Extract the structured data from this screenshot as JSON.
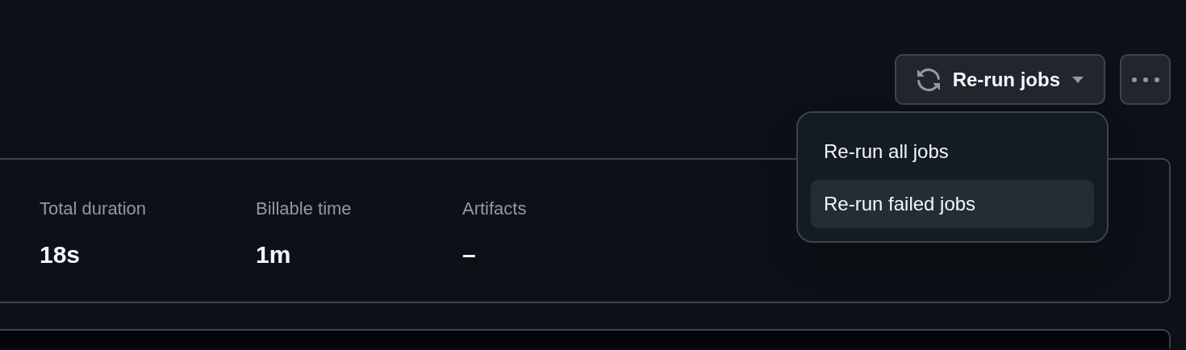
{
  "actions": {
    "rerun_button": {
      "label": "Re-run jobs"
    }
  },
  "rerun_menu": {
    "items": [
      {
        "label": "Re-run all jobs",
        "selected": false
      },
      {
        "label": "Re-run failed jobs",
        "selected": true
      }
    ]
  },
  "summary": {
    "stats": [
      {
        "label": "Total duration",
        "value": "18s"
      },
      {
        "label": "Billable time",
        "value": "1m"
      },
      {
        "label": "Artifacts",
        "value": "–"
      }
    ]
  }
}
